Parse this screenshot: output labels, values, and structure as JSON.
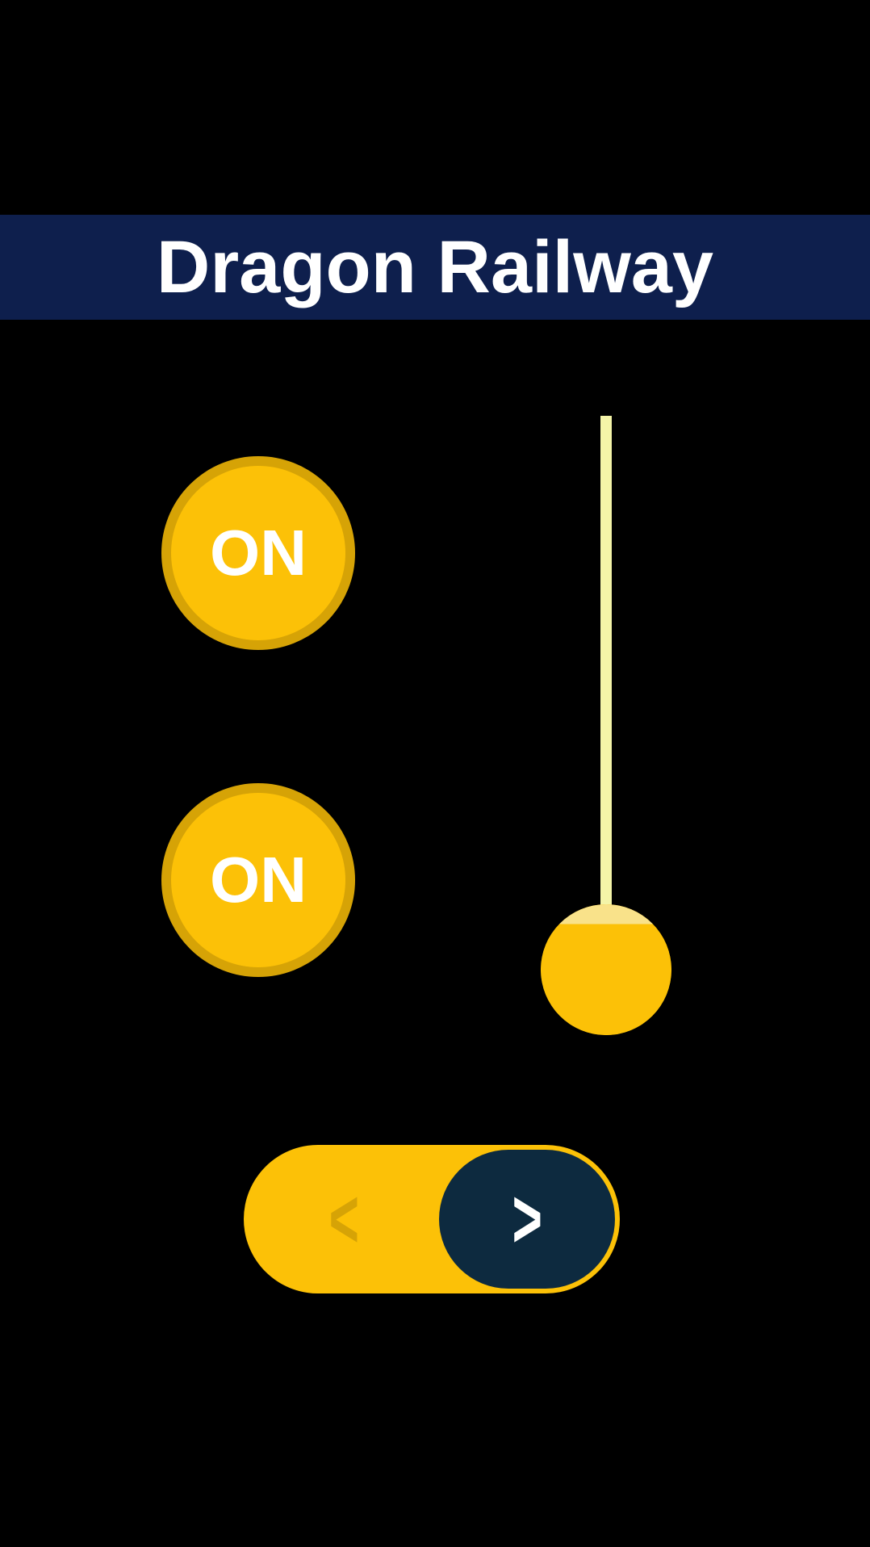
{
  "header": {
    "title": "Dragon Railway"
  },
  "buttons": {
    "on1_label": "ON",
    "on2_label": "ON"
  },
  "toggle": {
    "left_glyph": "<",
    "right_glyph": ">",
    "active": "right"
  },
  "slider": {
    "position": 100
  },
  "colors": {
    "background": "#000000",
    "header_bg": "#0e1f4d",
    "accent": "#fcc107",
    "accent_dark": "#d6a306",
    "toggle_active": "#0d2a3f",
    "slider_track": "#f4f4a8"
  }
}
